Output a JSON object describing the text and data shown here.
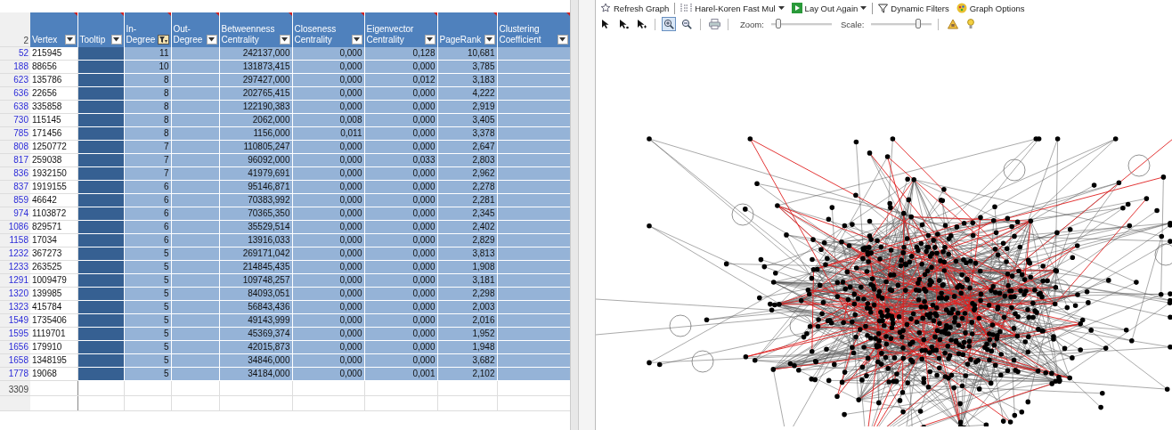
{
  "sheet": {
    "header_row_number": "2",
    "columns": [
      {
        "lines": [
          "Vertex"
        ],
        "filter_active": false
      },
      {
        "lines": [
          "Tooltip"
        ],
        "filter_active": false
      },
      {
        "lines": [
          "In-",
          "Degree"
        ],
        "filter_active": true
      },
      {
        "lines": [
          "Out-",
          "Degree"
        ],
        "filter_active": false
      },
      {
        "lines": [
          "Betweenness",
          "Centrality"
        ],
        "filter_active": false
      },
      {
        "lines": [
          "Closeness",
          "Centrality"
        ],
        "filter_active": false
      },
      {
        "lines": [
          "Eigenvector",
          "Centrality"
        ],
        "filter_active": false
      },
      {
        "lines": [
          "PageRank"
        ],
        "filter_active": false
      },
      {
        "lines": [
          "Clustering",
          "Coefficient"
        ],
        "filter_active": false
      }
    ],
    "rows": [
      {
        "row_number": "52",
        "vertex": "215945",
        "in_degree": "11",
        "betweenness": "242137,000",
        "closeness": "0,000",
        "eigenvector": "0,128",
        "pagerank": "10,681"
      },
      {
        "row_number": "188",
        "vertex": "88656",
        "in_degree": "10",
        "betweenness": "131873,415",
        "closeness": "0,000",
        "eigenvector": "0,000",
        "pagerank": "3,785"
      },
      {
        "row_number": "623",
        "vertex": "135786",
        "in_degree": "8",
        "betweenness": "297427,000",
        "closeness": "0,000",
        "eigenvector": "0,012",
        "pagerank": "3,183"
      },
      {
        "row_number": "636",
        "vertex": "22656",
        "in_degree": "8",
        "betweenness": "202765,415",
        "closeness": "0,000",
        "eigenvector": "0,000",
        "pagerank": "4,222"
      },
      {
        "row_number": "638",
        "vertex": "335858",
        "in_degree": "8",
        "betweenness": "122190,383",
        "closeness": "0,000",
        "eigenvector": "0,000",
        "pagerank": "2,919"
      },
      {
        "row_number": "730",
        "vertex": "115145",
        "in_degree": "8",
        "betweenness": "2062,000",
        "closeness": "0,008",
        "eigenvector": "0,000",
        "pagerank": "3,405"
      },
      {
        "row_number": "785",
        "vertex": "171456",
        "in_degree": "8",
        "betweenness": "1156,000",
        "closeness": "0,011",
        "eigenvector": "0,000",
        "pagerank": "3,378"
      },
      {
        "row_number": "808",
        "vertex": "1250772",
        "in_degree": "7",
        "betweenness": "110805,247",
        "closeness": "0,000",
        "eigenvector": "0,000",
        "pagerank": "2,647"
      },
      {
        "row_number": "817",
        "vertex": "259038",
        "in_degree": "7",
        "betweenness": "96092,000",
        "closeness": "0,000",
        "eigenvector": "0,033",
        "pagerank": "2,803"
      },
      {
        "row_number": "836",
        "vertex": "1932150",
        "in_degree": "7",
        "betweenness": "41979,691",
        "closeness": "0,000",
        "eigenvector": "0,000",
        "pagerank": "2,962"
      },
      {
        "row_number": "837",
        "vertex": "1919155",
        "in_degree": "6",
        "betweenness": "95146,871",
        "closeness": "0,000",
        "eigenvector": "0,000",
        "pagerank": "2,278"
      },
      {
        "row_number": "859",
        "vertex": "46642",
        "in_degree": "6",
        "betweenness": "70383,992",
        "closeness": "0,000",
        "eigenvector": "0,000",
        "pagerank": "2,281"
      },
      {
        "row_number": "974",
        "vertex": "1103872",
        "in_degree": "6",
        "betweenness": "70365,350",
        "closeness": "0,000",
        "eigenvector": "0,000",
        "pagerank": "2,345"
      },
      {
        "row_number": "1086",
        "vertex": "829571",
        "in_degree": "6",
        "betweenness": "35529,514",
        "closeness": "0,000",
        "eigenvector": "0,000",
        "pagerank": "2,402"
      },
      {
        "row_number": "1158",
        "vertex": "17034",
        "in_degree": "6",
        "betweenness": "13916,033",
        "closeness": "0,000",
        "eigenvector": "0,000",
        "pagerank": "2,829"
      },
      {
        "row_number": "1232",
        "vertex": "367273",
        "in_degree": "5",
        "betweenness": "269171,042",
        "closeness": "0,000",
        "eigenvector": "0,000",
        "pagerank": "3,813"
      },
      {
        "row_number": "1233",
        "vertex": "263525",
        "in_degree": "5",
        "betweenness": "214845,435",
        "closeness": "0,000",
        "eigenvector": "0,000",
        "pagerank": "1,908"
      },
      {
        "row_number": "1291",
        "vertex": "1009479",
        "in_degree": "5",
        "betweenness": "109748,257",
        "closeness": "0,000",
        "eigenvector": "0,000",
        "pagerank": "3,181"
      },
      {
        "row_number": "1320",
        "vertex": "139985",
        "in_degree": "5",
        "betweenness": "84093,051",
        "closeness": "0,000",
        "eigenvector": "0,000",
        "pagerank": "2,298"
      },
      {
        "row_number": "1323",
        "vertex": "415784",
        "in_degree": "5",
        "betweenness": "56843,436",
        "closeness": "0,000",
        "eigenvector": "0,000",
        "pagerank": "2,003"
      },
      {
        "row_number": "1549",
        "vertex": "1735406",
        "in_degree": "5",
        "betweenness": "49143,999",
        "closeness": "0,000",
        "eigenvector": "0,000",
        "pagerank": "2,016"
      },
      {
        "row_number": "1595",
        "vertex": "1119701",
        "in_degree": "5",
        "betweenness": "45369,374",
        "closeness": "0,000",
        "eigenvector": "0,000",
        "pagerank": "1,952"
      },
      {
        "row_number": "1656",
        "vertex": "179910",
        "in_degree": "5",
        "betweenness": "42015,873",
        "closeness": "0,000",
        "eigenvector": "0,000",
        "pagerank": "1,948"
      },
      {
        "row_number": "1658",
        "vertex": "1348195",
        "in_degree": "5",
        "betweenness": "34846,000",
        "closeness": "0,000",
        "eigenvector": "0,000",
        "pagerank": "3,682"
      },
      {
        "row_number": "1778",
        "vertex": "19068",
        "in_degree": "5",
        "betweenness": "34184,000",
        "closeness": "0,000",
        "eigenvector": "0,001",
        "pagerank": "2,102"
      }
    ],
    "blank_rows": [
      "3309"
    ]
  },
  "graph_toolbar": {
    "buttons": [
      {
        "kind": "refresh",
        "label": "Refresh Graph"
      },
      {
        "kind": "layout",
        "label": "Harel-Koren Fast Mul"
      },
      {
        "kind": "layout_again",
        "label": "Lay Out Again"
      },
      {
        "kind": "filters",
        "label": "Dynamic Filters"
      },
      {
        "kind": "options",
        "label": "Graph Options"
      }
    ],
    "tools": [
      {
        "kind": "select",
        "selected": false
      },
      {
        "kind": "select_vertex",
        "selected": false
      },
      {
        "kind": "select_subgraph",
        "selected": false
      },
      {
        "kind": "zoom_in",
        "selected": true
      },
      {
        "kind": "zoom_out",
        "selected": false
      }
    ],
    "zoom": {
      "label": "Zoom:",
      "level": 0.12
    },
    "scale": {
      "label": "Scale:",
      "level": 0.78
    }
  }
}
